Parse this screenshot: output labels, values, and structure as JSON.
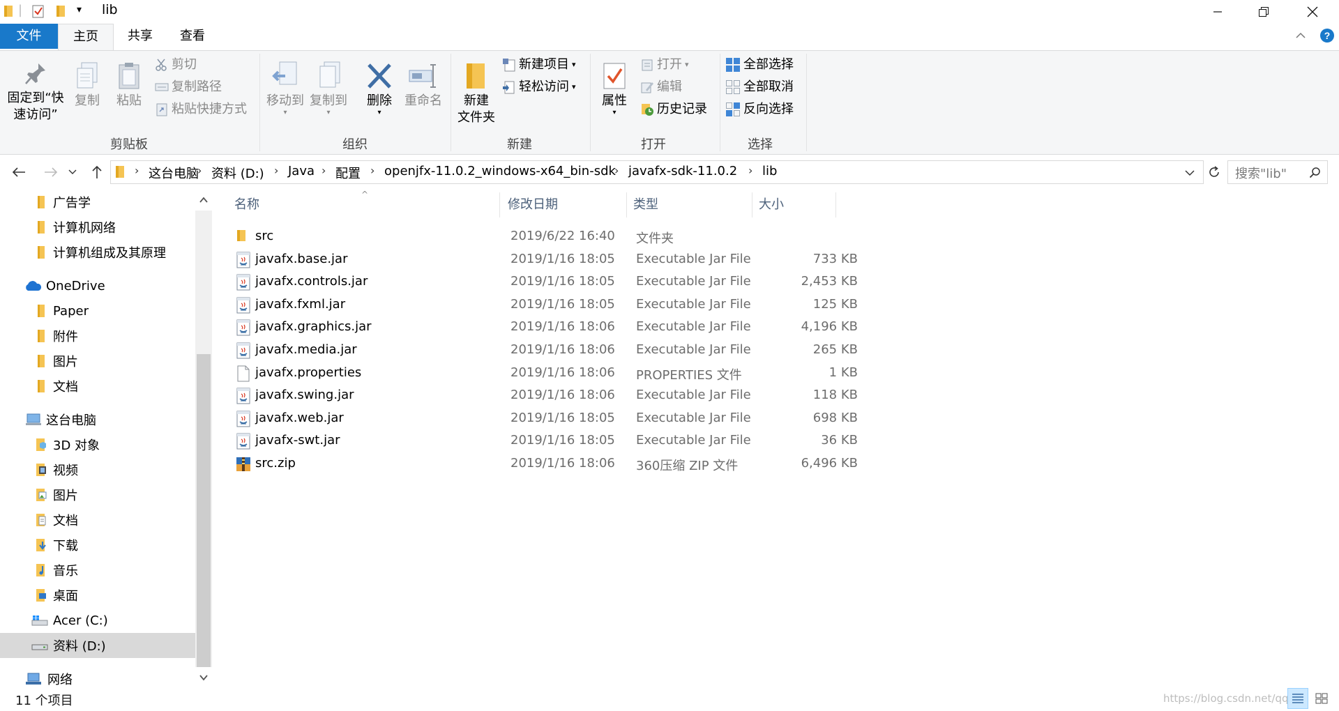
{
  "window": {
    "title": "lib",
    "quick_access_dropdown": "▾"
  },
  "ribbon": {
    "tabs": [
      "文件",
      "主页",
      "共享",
      "查看"
    ],
    "clipboard": {
      "pin_line1": "固定到“快",
      "pin_line2": "速访问”",
      "copy": "复制",
      "paste": "粘贴",
      "cut": "剪切",
      "copy_path": "复制路径",
      "paste_shortcut": "粘贴快捷方式",
      "group_label": "剪贴板"
    },
    "organize": {
      "move_to": "移动到",
      "copy_to": "复制到",
      "delete": "删除",
      "rename": "重命名",
      "group_label": "组织"
    },
    "new": {
      "new_folder_line1": "新建",
      "new_folder_line2": "文件夹",
      "new_item": "新建项目",
      "easy_access": "轻松访问",
      "group_label": "新建"
    },
    "open": {
      "properties": "属性",
      "open": "打开",
      "edit": "编辑",
      "history": "历史记录",
      "group_label": "打开"
    },
    "select": {
      "select_all": "全部选择",
      "select_none": "全部取消",
      "invert": "反向选择",
      "group_label": "选择"
    }
  },
  "address": {
    "crumbs": [
      "这台电脑",
      "资料 (D:)",
      "Java",
      "配置",
      "openjfx-11.0.2_windows-x64_bin-sdk",
      "javafx-sdk-11.0.2",
      "lib"
    ],
    "search_placeholder": "搜索\"lib\""
  },
  "nav": {
    "items": [
      {
        "label": "广告学",
        "icon": "folder-icon"
      },
      {
        "label": "计算机网络",
        "icon": "folder-icon"
      },
      {
        "label": "计算机组成及其原理",
        "icon": "folder-icon"
      },
      {
        "label": "OneDrive",
        "icon": "onedrive-icon"
      },
      {
        "label": "Paper",
        "icon": "folder-icon"
      },
      {
        "label": "附件",
        "icon": "folder-icon"
      },
      {
        "label": "图片",
        "icon": "folder-icon"
      },
      {
        "label": "文档",
        "icon": "folder-icon"
      },
      {
        "label": "这台电脑",
        "icon": "pc-icon"
      },
      {
        "label": "3D 对象",
        "icon": "3d-objects-icon"
      },
      {
        "label": "视频",
        "icon": "videos-icon"
      },
      {
        "label": "图片",
        "icon": "pictures-icon"
      },
      {
        "label": "文档",
        "icon": "documents-icon"
      },
      {
        "label": "下载",
        "icon": "downloads-icon"
      },
      {
        "label": "音乐",
        "icon": "music-icon"
      },
      {
        "label": "桌面",
        "icon": "desktop-icon"
      },
      {
        "label": "Acer (C:)",
        "icon": "windows-drive-icon"
      },
      {
        "label": "资料 (D:)",
        "icon": "drive-icon",
        "selected": true
      },
      {
        "label": "网络",
        "icon": "network-icon"
      }
    ]
  },
  "files": {
    "headers": [
      "名称",
      "修改日期",
      "类型",
      "大小"
    ],
    "rows": [
      {
        "name": "src",
        "date": "2019/6/22 16:40",
        "type": "文件夹",
        "size": "",
        "icon": "folder-icon"
      },
      {
        "name": "javafx.base.jar",
        "date": "2019/1/16 18:05",
        "type": "Executable Jar File",
        "size": "733 KB",
        "icon": "jar-icon"
      },
      {
        "name": "javafx.controls.jar",
        "date": "2019/1/16 18:05",
        "type": "Executable Jar File",
        "size": "2,453 KB",
        "icon": "jar-icon"
      },
      {
        "name": "javafx.fxml.jar",
        "date": "2019/1/16 18:05",
        "type": "Executable Jar File",
        "size": "125 KB",
        "icon": "jar-icon"
      },
      {
        "name": "javafx.graphics.jar",
        "date": "2019/1/16 18:06",
        "type": "Executable Jar File",
        "size": "4,196 KB",
        "icon": "jar-icon"
      },
      {
        "name": "javafx.media.jar",
        "date": "2019/1/16 18:06",
        "type": "Executable Jar File",
        "size": "265 KB",
        "icon": "jar-icon"
      },
      {
        "name": "javafx.properties",
        "date": "2019/1/16 18:06",
        "type": "PROPERTIES 文件",
        "size": "1 KB",
        "icon": "file-icon"
      },
      {
        "name": "javafx.swing.jar",
        "date": "2019/1/16 18:06",
        "type": "Executable Jar File",
        "size": "118 KB",
        "icon": "jar-icon"
      },
      {
        "name": "javafx.web.jar",
        "date": "2019/1/16 18:05",
        "type": "Executable Jar File",
        "size": "698 KB",
        "icon": "jar-icon"
      },
      {
        "name": "javafx-swt.jar",
        "date": "2019/1/16 18:05",
        "type": "Executable Jar File",
        "size": "36 KB",
        "icon": "jar-icon"
      },
      {
        "name": "src.zip",
        "date": "2019/1/16 18:06",
        "type": "360压缩 ZIP 文件",
        "size": "6,496 KB",
        "icon": "zip-icon"
      }
    ]
  },
  "status": {
    "item_count": "11 个项目",
    "watermark": "https://blog.csdn.net/qq_4"
  },
  "colors": {
    "accent": "#1979ca",
    "folder": "#f5c453",
    "ribbon_bg": "#f5f6f7",
    "selected_bg": "#d9d9d9",
    "header_text": "#4c607a"
  }
}
